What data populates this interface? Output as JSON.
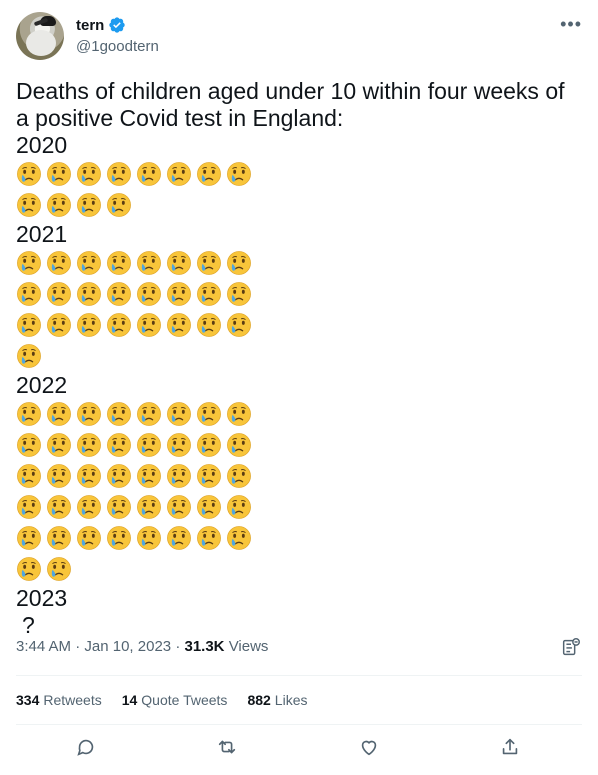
{
  "author": {
    "display_name": "tern",
    "handle": "@1goodtern",
    "verified_icon": "verified-badge-icon",
    "accent": "#1d9bf0"
  },
  "tweet": {
    "lines": [
      "Deaths of children aged under 10 within four weeks of",
      "a positive Covid test in England:"
    ],
    "sections": [
      {
        "year": "2020",
        "count": 12
      },
      {
        "year": "2021",
        "count": 25
      },
      {
        "year": "2022",
        "count": 42
      },
      {
        "year": "2023",
        "value": "?"
      }
    ],
    "emoji_icon": "crying-face-emoji",
    "emoji_per_row": 8
  },
  "meta": {
    "time": "3:44 AM",
    "date": "Jan 10, 2023",
    "views_count": "31.3K",
    "views_label": "Views"
  },
  "stats": [
    {
      "count": "334",
      "label": "Retweets"
    },
    {
      "count": "14",
      "label": "Quote Tweets"
    },
    {
      "count": "882",
      "label": "Likes"
    }
  ],
  "actions": [
    "reply-icon",
    "retweet-icon",
    "like-icon",
    "share-icon"
  ]
}
